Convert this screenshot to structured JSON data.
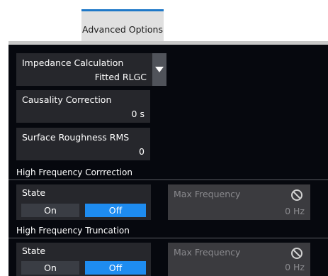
{
  "tab": {
    "label": "Advanced Options"
  },
  "impedance": {
    "label": "Impedance Calculation",
    "value": "Fitted RLGC"
  },
  "causality": {
    "label": "Causality Correction",
    "value": "0 s"
  },
  "roughness": {
    "label": "Surface Roughness RMS",
    "value": "0"
  },
  "hf_correction": {
    "section": "High Frequency Corrrection",
    "state_label": "State",
    "on_label": "On",
    "off_label": "Off",
    "max_freq_label": "Max Frequency",
    "max_freq_value": "0 Hz"
  },
  "hf_truncation": {
    "section": "High Frequency Truncation",
    "state_label": "State",
    "on_label": "On",
    "off_label": "Off",
    "max_freq_label": "Max Frequency",
    "max_freq_value": "0 Hz"
  },
  "colors": {
    "accent": "#1e8cf0",
    "tab_border": "#1e78c8"
  }
}
